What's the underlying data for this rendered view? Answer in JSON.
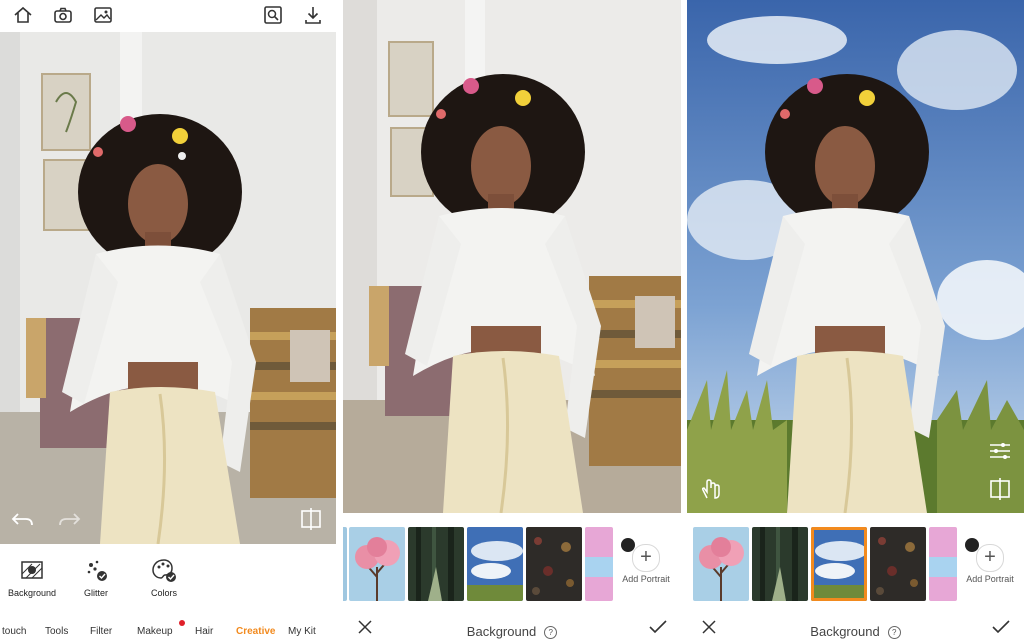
{
  "panel1": {
    "toolbar_icons": [
      "home-icon",
      "camera-icon",
      "gallery-icon",
      "search-image-icon",
      "download-icon"
    ],
    "canvas_icons": [
      "undo-icon",
      "redo-icon",
      "compare-icon"
    ],
    "tools": [
      {
        "label": "Background",
        "icon": "background-icon"
      },
      {
        "label": "Glitter",
        "icon": "glitter-icon"
      },
      {
        "label": "Colors",
        "icon": "colors-icon"
      }
    ],
    "nav": [
      "touch",
      "Tools",
      "Filter",
      "Makeup",
      "Hair",
      "Creative",
      "My Kit"
    ],
    "nav_active": "Creative"
  },
  "panel2": {
    "add_portrait_label": "Add Portrait",
    "bottom_title": "Background",
    "help_glyph": "?"
  },
  "panel3": {
    "add_portrait_label": "Add Portrait",
    "bottom_title": "Background",
    "help_glyph": "?",
    "canvas_icons": [
      "hand-gesture-icon",
      "adjust-sliders-icon",
      "compare-icon"
    ]
  },
  "colors": {
    "accent": "#f28a1e",
    "badge": "#e0202a"
  }
}
